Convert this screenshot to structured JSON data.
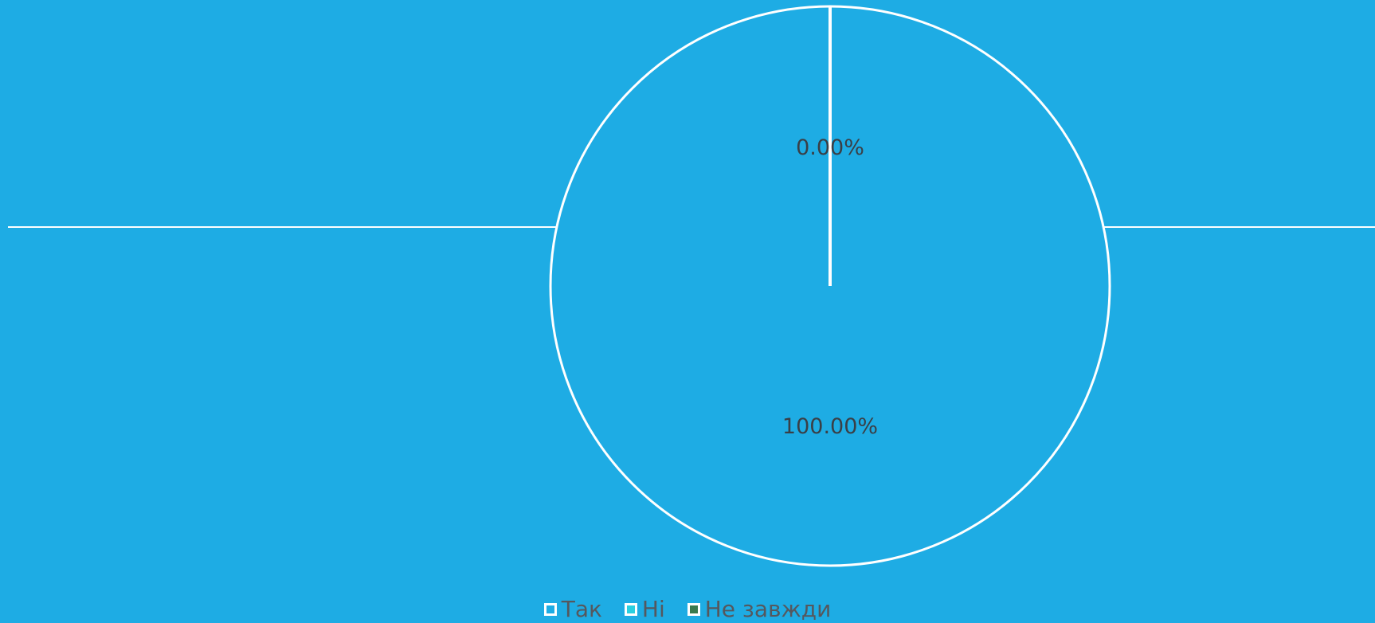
{
  "chart_data": {
    "type": "pie",
    "categories": [
      "Так",
      "Ні",
      "Не  завжди"
    ],
    "values": [
      100,
      0,
      0
    ],
    "data_labels": [
      "100.00%",
      "0.00%"
    ],
    "colors": [
      "#1eace4",
      "#2ad0e0",
      "#3a7a4e"
    ],
    "background": "#1eace4",
    "legend": "bottom"
  },
  "legend": {
    "items": [
      {
        "label": "Так",
        "color": "#1eace4"
      },
      {
        "label": "Ні",
        "color": "#2ad0e0"
      },
      {
        "label": "Не  завжди",
        "color": "#3a7a4e"
      }
    ]
  }
}
